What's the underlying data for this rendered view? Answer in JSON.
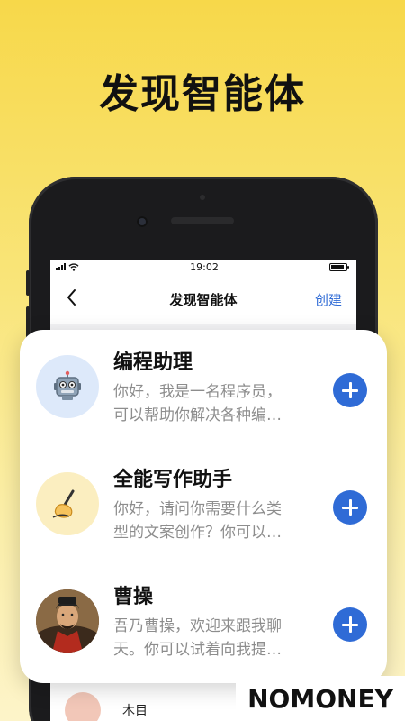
{
  "headline": "发现智能体",
  "status_bar": {
    "time": "19:02"
  },
  "nav": {
    "title": "发现智能体",
    "create_label": "创建"
  },
  "agents": [
    {
      "name": "编程助理",
      "description": "你好，我是一名程序员，\n可以帮助你解决各种编…",
      "icon": "robot-icon",
      "avatar_color": "#dde9fa"
    },
    {
      "name": "全能写作助手",
      "description": "你好，请问你需要什么类\n型的文案创作？你可以…",
      "icon": "writing-hand-icon",
      "avatar_color": "#fbeec0"
    },
    {
      "name": "曹操",
      "description": "吾乃曹操，欢迎来跟我聊\n天。你可以试着向我提…",
      "icon": "portrait-avatar",
      "avatar_color": "#6b4a2e"
    }
  ],
  "behind_list": [
    {
      "name": "木目",
      "avatar_color": "#f2c7b8"
    }
  ],
  "colors": {
    "accent": "#2f6bd6",
    "background_top": "#f7d84a"
  },
  "watermark": "NOMONEY"
}
